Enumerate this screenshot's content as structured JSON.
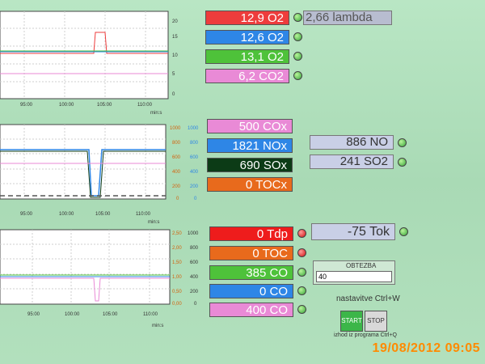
{
  "colors": {
    "red": "#ee3c3c",
    "blue": "#2e86e6",
    "green": "#4ec23a",
    "magenta": "#e98ad6",
    "darkgreen": "#0c3b16",
    "orange": "#e86a1c"
  },
  "charts": [
    {
      "xticks": [
        "95:00",
        "100:00",
        "105:00",
        "110:00"
      ],
      "xunit": "min:s",
      "right1": [
        "20",
        "15",
        "10",
        "5",
        "0"
      ],
      "right2": []
    },
    {
      "xticks": [
        "95:00",
        "100:00",
        "105:00",
        "110:00"
      ],
      "xunit": "min:s",
      "right1": [
        "1000",
        "800",
        "600",
        "400",
        "200",
        "0"
      ],
      "right2": [
        "1000",
        "800",
        "600",
        "400",
        "200",
        "0"
      ]
    },
    {
      "xticks": [
        "95:00",
        "100:00",
        "105:00",
        "110:00"
      ],
      "xunit": "min:s",
      "right1": [
        "2,50",
        "2,00",
        "1,50",
        "1,00",
        "0,50",
        "0,00"
      ],
      "right2": [
        "1000",
        "800",
        "600",
        "400",
        "200",
        "0"
      ],
      "right3": [
        "1000",
        "800",
        "600",
        "400",
        "200",
        "0"
      ]
    }
  ],
  "o2_group": [
    {
      "text": "12,9 O2",
      "color": "red"
    },
    {
      "text": "12,6 O2",
      "color": "blue"
    },
    {
      "text": "13,1 O2",
      "color": "green"
    },
    {
      "text": "6,2 CO2",
      "color": "magenta"
    }
  ],
  "lambda": "2,66 lambda",
  "cox_group": [
    {
      "text": "500 COx",
      "color": "magenta"
    },
    {
      "text": "1821 NOx",
      "color": "blue"
    },
    {
      "text": "690 SOx",
      "color": "darkgreen"
    },
    {
      "text": "0 TOCx",
      "color": "orange"
    }
  ],
  "no": "886 NO",
  "so2": "241 SO2",
  "tdp_group": [
    {
      "text": "0 Tdp",
      "color": "red"
    },
    {
      "text": "0 TOC",
      "color": "orange"
    },
    {
      "text": "385 CO",
      "color": "green"
    },
    {
      "text": "0 CO",
      "color": "blue"
    },
    {
      "text": "400 CO",
      "color": "magenta"
    }
  ],
  "tok": "-75 Tok",
  "obrezba": {
    "label": "OBTEZBA",
    "value": "40"
  },
  "shortcut": "nastavitve Ctrl+W",
  "start_label": "START",
  "stop_label": "STOP",
  "exit_text": "izhod iz programa Ctrl+Q",
  "timestamp": "19/08/2012 09:05"
}
